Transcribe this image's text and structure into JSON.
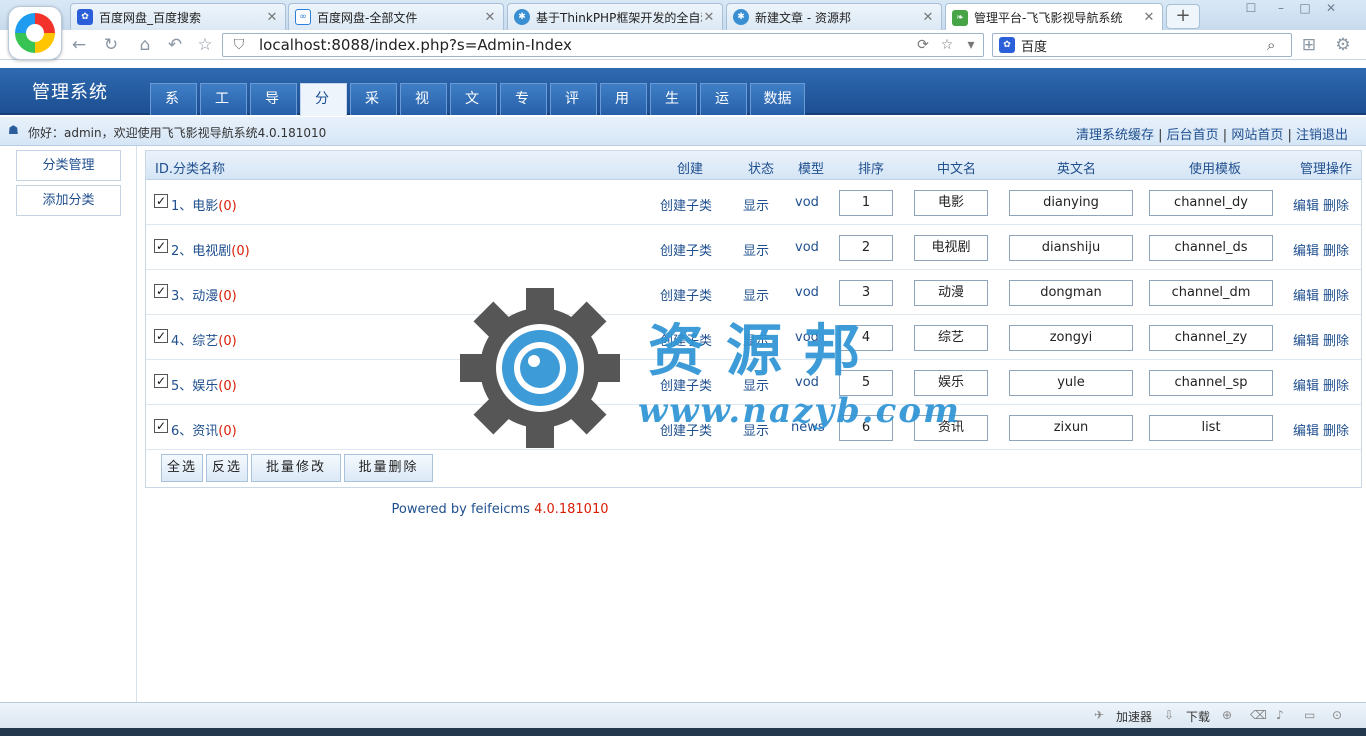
{
  "browser": {
    "tabs": [
      {
        "label": "百度网盘_百度搜索",
        "icon": "paw-icon",
        "color": "#2b5fd9"
      },
      {
        "label": "百度网盘-全部文件",
        "icon": "cloud-icon",
        "color": "#2b7fd9"
      },
      {
        "label": "基于ThinkPHP框架开发的全自动",
        "icon": "site-icon",
        "color": "#3a8ed2"
      },
      {
        "label": "新建文章 - 资源邦",
        "icon": "site-icon",
        "color": "#3a8ed2"
      },
      {
        "label": "管理平台-飞飞影视导航系统",
        "icon": "leaf-icon",
        "color": "#47a447"
      }
    ],
    "url": "localhost:8088/index.php?s=Admin-Index",
    "search_engine": "百度"
  },
  "admin": {
    "title": "管理系统",
    "menu": [
      "系统",
      "工具",
      "导航",
      "分类",
      "采集",
      "视频",
      "文章",
      "专题",
      "评论",
      "用户",
      "生成",
      "运营",
      "数据库"
    ],
    "active_menu": "分类",
    "welcome": "你好：admin，欢迎使用飞飞影视导航系统4.0.181010",
    "quick_links": [
      "清理系统缓存",
      "后台首页",
      "网站首页",
      "注销退出"
    ]
  },
  "sidebar": {
    "items": [
      "分类管理",
      "添加分类"
    ]
  },
  "table": {
    "headers": {
      "id_name": "ID.分类名称",
      "create": "创建",
      "status": "状态",
      "model": "模型",
      "order": "排序",
      "cn_name": "中文名",
      "en_name": "英文名",
      "template": "使用模板",
      "ops": "管理操作"
    },
    "rows": [
      {
        "label": "1、电影",
        "count": "(0)",
        "create": "创建子类",
        "status": "显示",
        "model": "vod",
        "order": "1",
        "cn": "电影",
        "en": "dianying",
        "tpl": "channel_dy",
        "edit": "编辑",
        "del": "删除"
      },
      {
        "label": "2、电视剧",
        "count": "(0)",
        "create": "创建子类",
        "status": "显示",
        "model": "vod",
        "order": "2",
        "cn": "电视剧",
        "en": "dianshiju",
        "tpl": "channel_ds",
        "edit": "编辑",
        "del": "删除"
      },
      {
        "label": "3、动漫",
        "count": "(0)",
        "create": "创建子类",
        "status": "显示",
        "model": "vod",
        "order": "3",
        "cn": "动漫",
        "en": "dongman",
        "tpl": "channel_dm",
        "edit": "编辑",
        "del": "删除"
      },
      {
        "label": "4、综艺",
        "count": "(0)",
        "create": "创建子类",
        "status": "显示",
        "model": "vod",
        "order": "4",
        "cn": "综艺",
        "en": "zongyi",
        "tpl": "channel_zy",
        "edit": "编辑",
        "del": "删除"
      },
      {
        "label": "5、娱乐",
        "count": "(0)",
        "create": "创建子类",
        "status": "显示",
        "model": "vod",
        "order": "5",
        "cn": "娱乐",
        "en": "yule",
        "tpl": "channel_sp",
        "edit": "编辑",
        "del": "删除"
      },
      {
        "label": "6、资讯",
        "count": "(0)",
        "create": "创建子类",
        "status": "显示",
        "model": "news",
        "order": "6",
        "cn": "资讯",
        "en": "zixun",
        "tpl": "list",
        "edit": "编辑",
        "del": "删除"
      }
    ],
    "actions": [
      "全选",
      "反选",
      "批量修改",
      "批量删除"
    ]
  },
  "footer": {
    "powered": "Powered by feifeicms ",
    "version": "4.0.181010"
  },
  "watermark": {
    "name": "资源邦",
    "url": "www.nazyb.com"
  },
  "statusbar": {
    "accelerator": "加速器",
    "download": "下载"
  },
  "colors": {
    "header": "#1d4f93",
    "link": "#1f4f8f",
    "count": "#d81e06",
    "watermark": "#2f95d4"
  }
}
